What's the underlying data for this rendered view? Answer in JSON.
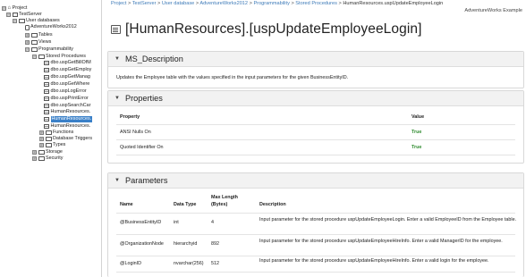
{
  "tree": {
    "project": "Project",
    "server": "TestServer",
    "user_databases": "User databases",
    "database": "AdventureWorks2012",
    "tables": "Tables",
    "views": "Views",
    "programmability": "Programmability",
    "stored_procedures": "Stored Procedures",
    "procedures": [
      "dbo.uspGetBillOfM",
      "dbo.uspGetEmploy",
      "dbo.uspGetManag",
      "dbo.uspGetWhere",
      "dbo.uspLogError",
      "dbo.uspPrintError",
      "dbo.uspSearchCar",
      "HumanResources.",
      "HumanResources.",
      "HumanResources."
    ],
    "functions": "Functions",
    "database_triggers": "Database Triggers",
    "types": "Types",
    "storage": "Storage",
    "security": "Security"
  },
  "breadcrumb": {
    "project": "Project",
    "server": "TestServer",
    "user_database": "User database",
    "database": "AdventureWorks2012",
    "programmability": "Programmability",
    "stored_procedures": "Stored Procedures",
    "current": "HumanResources.uspUpdateEmployeeLogin",
    "separator": ">"
  },
  "project_name": "AdventureWorks Example",
  "page_title": "[HumanResources].[uspUpdateEmployeeLogin]",
  "ms_description": {
    "heading": "MS_Description",
    "text": "Updates the Employee table with the values specified in the input parameters for the given BusinessEntityID."
  },
  "properties": {
    "heading": "Properties",
    "columns": [
      "Property",
      "Value"
    ],
    "rows": [
      {
        "property": "ANSI Nulls On",
        "value": "True"
      },
      {
        "property": "Quoted Identifier On",
        "value": "True"
      }
    ]
  },
  "parameters": {
    "heading": "Parameters",
    "columns": {
      "name": "Name",
      "type": "Data Type",
      "maxlen_1": "Max Length",
      "maxlen_2": "(Bytes)",
      "description": "Description"
    },
    "rows": [
      {
        "name": "@BusinessEntityID",
        "type": "int",
        "maxlen": "4",
        "description": "Input parameter for the stored procedure uspUpdateEmployeeLogin. Enter a valid EmployeeID from the Employee table."
      },
      {
        "name": "@OrganizationNode",
        "type": "hierarchyid",
        "maxlen": "892",
        "description": "Input parameter for the stored procedure uspUpdateEmployeeHireInfo. Enter a valid ManagerID for the employee."
      },
      {
        "name": "@LoginID",
        "type": "nvarchar(256)",
        "maxlen": "512",
        "description": "Input parameter for the stored procedure uspUpdateEmployeeHireInfo. Enter a valid login for the employee."
      }
    ]
  },
  "icons": {
    "expand": "⊞",
    "collapse": "⊟",
    "caret": "▼",
    "home": "⌂"
  },
  "colors": {
    "link": "#3d7ab8",
    "true_value": "#2e8b2e",
    "selected": "#3a80c8"
  }
}
